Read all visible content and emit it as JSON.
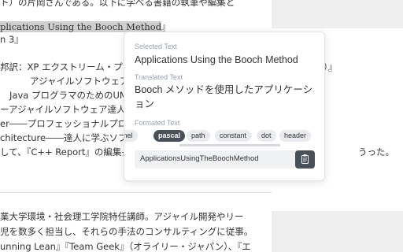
{
  "background_text": {
    "line1_before": "ト）の片岡さんである。以下に学べる書籍の執筆や編集と",
    "line1_selected": "plications Using the Booch Method",
    "line1_after": "』",
    "line2": "n 3』",
    "line3": "邦訳：XP エクストリーム・プ",
    "line3_tail": "）』",
    "line4": "アジャイルソフトウェア開発",
    "line5": "Java プログラマのためのUML",
    "line6": "ーアジャイルソフトウェア達人",
    "line7": "er――プロフェッショナルプロ",
    "line8": "chitecture――達人に学ぶソフト",
    "line9": "して、『C++ Report』の編集長",
    "line9_tail": "うった。",
    "line10": "業大学環境・社会理工学院特任講師。アジャイル開発やリー",
    "line11": "児を数多く担当し、それらの手法のコンサルティングに従事。",
    "line12": "unning Lean』『Team Geek』（オライリー・ジャパン）、『エ"
  },
  "popup": {
    "selected_label": "Selected Text",
    "selected_value": "Applications Using the Booch Method",
    "translated_label": "Translated Text",
    "translated_value": "Booch メソッドを使用したアプリケーション",
    "formatted_label": "Formated Text",
    "formats": [
      "mel",
      "pascal",
      "path",
      "constant",
      "dot",
      "header"
    ],
    "active_format": "pascal",
    "result_value": "ApplicationsUsingTheBoochMethod",
    "copy_icon": "clipboard-icon"
  }
}
